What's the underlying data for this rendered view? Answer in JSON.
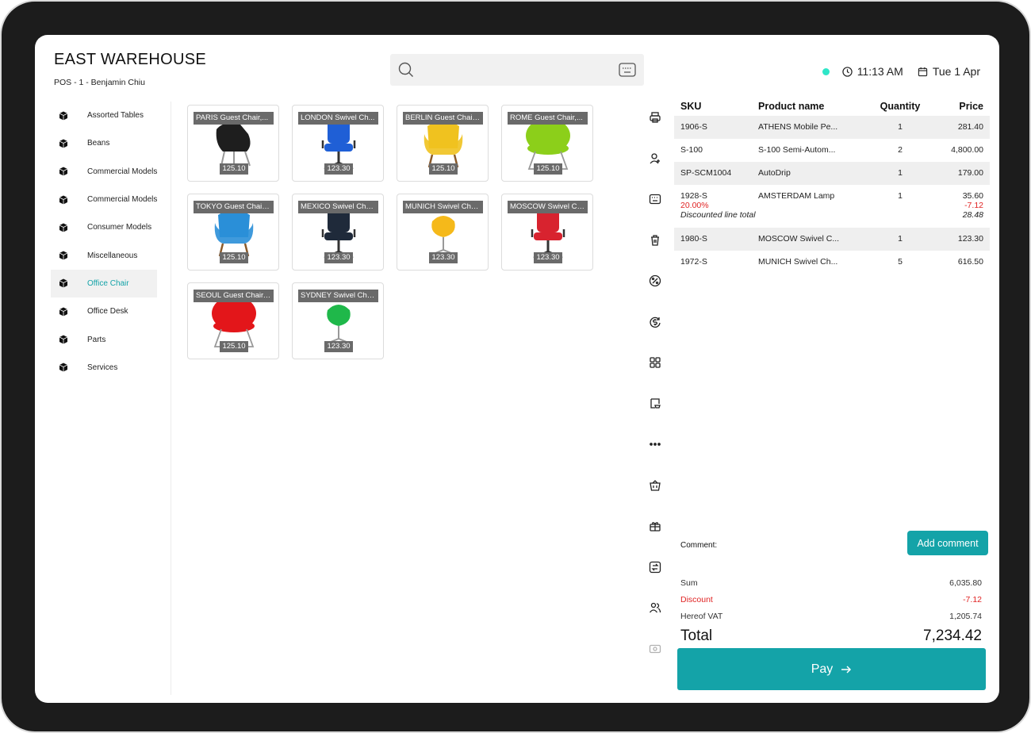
{
  "header": {
    "store_name": "EAST WAREHOUSE",
    "pos_user": "POS - 1 - Benjamin Chiu",
    "time": "11:13 AM",
    "date": "Tue 1 Apr"
  },
  "search": {
    "placeholder": ""
  },
  "categories": [
    {
      "label": "Assorted Tables"
    },
    {
      "label": "Beans"
    },
    {
      "label": "Commercial Models"
    },
    {
      "label": "Commercial Models"
    },
    {
      "label": "Consumer Models"
    },
    {
      "label": "Miscellaneous"
    },
    {
      "label": "Office Chair",
      "active": true
    },
    {
      "label": "Office Desk"
    },
    {
      "label": "Parts"
    },
    {
      "label": "Services"
    }
  ],
  "products": [
    {
      "name": "PARIS Guest Chair,...",
      "price": "125.10",
      "color": "#1e1e1e",
      "style": "lounge"
    },
    {
      "name": "LONDON Swivel Ch...",
      "price": "123.30",
      "color": "#1f5fd6",
      "style": "swivel"
    },
    {
      "name": "BERLIN Guest Chair,...",
      "price": "125.10",
      "color": "#f0c21f",
      "style": "wing"
    },
    {
      "name": "ROME Guest Chair,...",
      "price": "125.10",
      "color": "#8ccf1a",
      "style": "tub"
    },
    {
      "name": "TOKYO Guest Chair,...",
      "price": "125.10",
      "color": "#2a8fd8",
      "style": "wing"
    },
    {
      "name": "MEXICO Swivel Chai...",
      "price": "123.30",
      "color": "#1f2a3a",
      "style": "swivel"
    },
    {
      "name": "MUNICH Swivel Cha...",
      "price": "123.30",
      "color": "#f5b91a",
      "style": "egg"
    },
    {
      "name": "MOSCOW Swivel Ch...",
      "price": "123.30",
      "color": "#d8232f",
      "style": "swivel"
    },
    {
      "name": "SEOUL Guest Chair,...",
      "price": "125.10",
      "color": "#e3161a",
      "style": "tub"
    },
    {
      "name": "SYDNEY Swivel Cha...",
      "price": "123.30",
      "color": "#1fb84a",
      "style": "egg"
    }
  ],
  "order": {
    "headers": {
      "sku": "SKU",
      "name": "Product name",
      "qty": "Quantity",
      "price": "Price"
    },
    "lines": [
      {
        "sku": "1906-S",
        "name": "ATHENS Mobile Pe...",
        "qty": "1",
        "price": "281.40"
      },
      {
        "sku": "S-100",
        "name": "S-100 Semi-Autom...",
        "qty": "2",
        "price": "4,800.00"
      },
      {
        "sku": "SP-SCM1004",
        "name": "AutoDrip",
        "qty": "1",
        "price": "179.00"
      },
      {
        "sku": "1928-S",
        "name": "AMSTERDAM Lamp",
        "qty": "1",
        "price": "35.60",
        "discount_pct": "20.00%",
        "discount_amount": "-7.12",
        "discounted_label": "Discounted line total",
        "discounted_total": "28.48"
      },
      {
        "sku": "1980-S",
        "name": "MOSCOW Swivel C...",
        "qty": "1",
        "price": "123.30"
      },
      {
        "sku": "1972-S",
        "name": "MUNICH Swivel Ch...",
        "qty": "5",
        "price": "616.50"
      }
    ]
  },
  "comment": {
    "label": "Comment:",
    "button": "Add comment"
  },
  "totals": {
    "sum_label": "Sum",
    "sum": "6,035.80",
    "discount_label": "Discount",
    "discount": "-7.12",
    "vat_label": "Hereof VAT",
    "vat": "1,205.74",
    "total_label": "Total",
    "total": "7,234.42"
  },
  "pay": {
    "label": "Pay"
  },
  "toolbar_icons": [
    "printer-icon",
    "user-plus-icon",
    "keyboard-icon",
    "trash-icon",
    "percent-icon",
    "dollar-refresh-icon",
    "grid-icon",
    "cart-clipboard-icon",
    "more-icon",
    "basket-icon",
    "gift-icon",
    "transfer-icon",
    "users-icon",
    "cash-icon"
  ],
  "colors": {
    "accent": "#14a3a8",
    "online": "#2ee6c8",
    "negative": "#e02424"
  }
}
